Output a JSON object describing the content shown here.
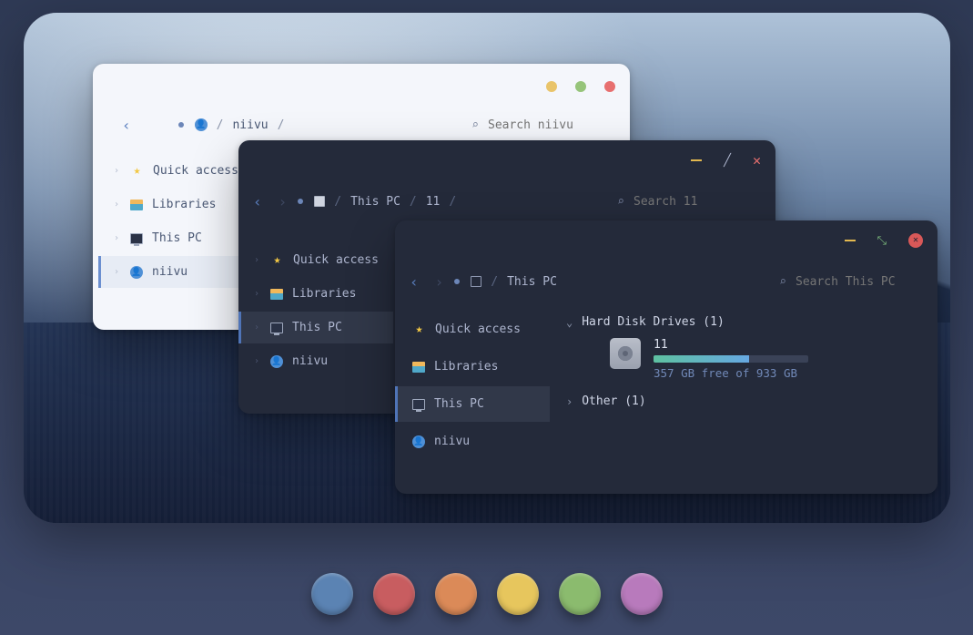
{
  "windows": {
    "w1": {
      "titlebar": {
        "variant": "mac-dots"
      },
      "breadcrumb": {
        "user_icon": "user",
        "name": "niivu"
      },
      "search_placeholder": "Search niivu",
      "sidebar": [
        {
          "icon": "star",
          "label": "Quick access",
          "selected": false
        },
        {
          "icon": "lib",
          "label": "Libraries",
          "selected": false
        },
        {
          "icon": "pc",
          "label": "This PC",
          "selected": false
        },
        {
          "icon": "user",
          "label": "niivu",
          "selected": true
        }
      ]
    },
    "w2": {
      "titlebar": {
        "variant": "win-dark"
      },
      "breadcrumb": {
        "part1": "This PC",
        "part2": "11"
      },
      "search_placeholder": "Search 11",
      "sidebar": [
        {
          "icon": "star",
          "label": "Quick access",
          "selected": false
        },
        {
          "icon": "lib",
          "label": "Libraries",
          "selected": false
        },
        {
          "icon": "pc",
          "label": "This PC",
          "selected": true
        },
        {
          "icon": "user",
          "label": "niivu",
          "selected": false
        }
      ]
    },
    "w3": {
      "titlebar": {
        "variant": "win-dark-circle"
      },
      "breadcrumb": {
        "part1": "This PC"
      },
      "search_placeholder": "Search This PC",
      "sidebar": [
        {
          "icon": "star",
          "label": "Quick access",
          "selected": false
        },
        {
          "icon": "lib",
          "label": "Libraries",
          "selected": false
        },
        {
          "icon": "pc",
          "label": "This PC",
          "selected": true
        },
        {
          "icon": "user",
          "label": "niivu",
          "selected": false
        }
      ],
      "content": {
        "categories": [
          {
            "label": "Hard Disk Drives (1)",
            "expanded": true,
            "drives": [
              {
                "name": "11",
                "used_pct": 62,
                "free_text": "357 GB free of 933 GB"
              }
            ]
          },
          {
            "label": "Other (1)",
            "expanded": false
          }
        ]
      }
    }
  },
  "palette": [
    "#5b83b3",
    "#c85d60",
    "#db8a58",
    "#e7c65d",
    "#8bbb6e",
    "#b87abc"
  ]
}
